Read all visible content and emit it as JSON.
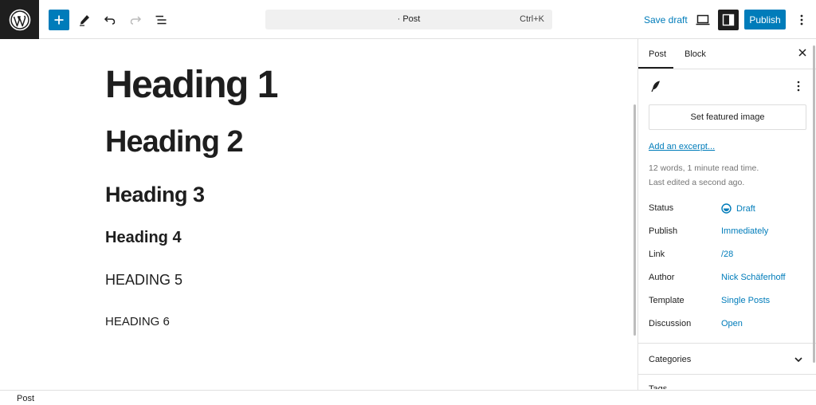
{
  "toolbar": {
    "search_title": "· Post",
    "search_shortcut": "Ctrl+K",
    "save_draft": "Save draft",
    "publish": "Publish"
  },
  "canvas": {
    "headings": [
      "Heading 1",
      "Heading 2",
      "Heading 3",
      "Heading 4",
      "HEADING 5",
      "HEADING 6"
    ]
  },
  "sidebar": {
    "tabs": {
      "post": "Post",
      "block": "Block"
    },
    "featured_image": "Set featured image",
    "excerpt_link": "Add an excerpt...",
    "meta_words": "12 words, 1 minute read time.",
    "meta_edited": "Last edited a second ago.",
    "rows": [
      {
        "label": "Status",
        "value": "Draft"
      },
      {
        "label": "Publish",
        "value": "Immediately"
      },
      {
        "label": "Link",
        "value": "/28"
      },
      {
        "label": "Author",
        "value": "Nick Schäferhoff"
      },
      {
        "label": "Template",
        "value": "Single Posts"
      },
      {
        "label": "Discussion",
        "value": "Open"
      }
    ],
    "categories": "Categories",
    "tags": "Tags"
  },
  "footer": {
    "breadcrumb": "Post"
  },
  "colors": {
    "accent": "#007cba",
    "dark": "#1e1e1e",
    "border": "#e0e0e0"
  }
}
